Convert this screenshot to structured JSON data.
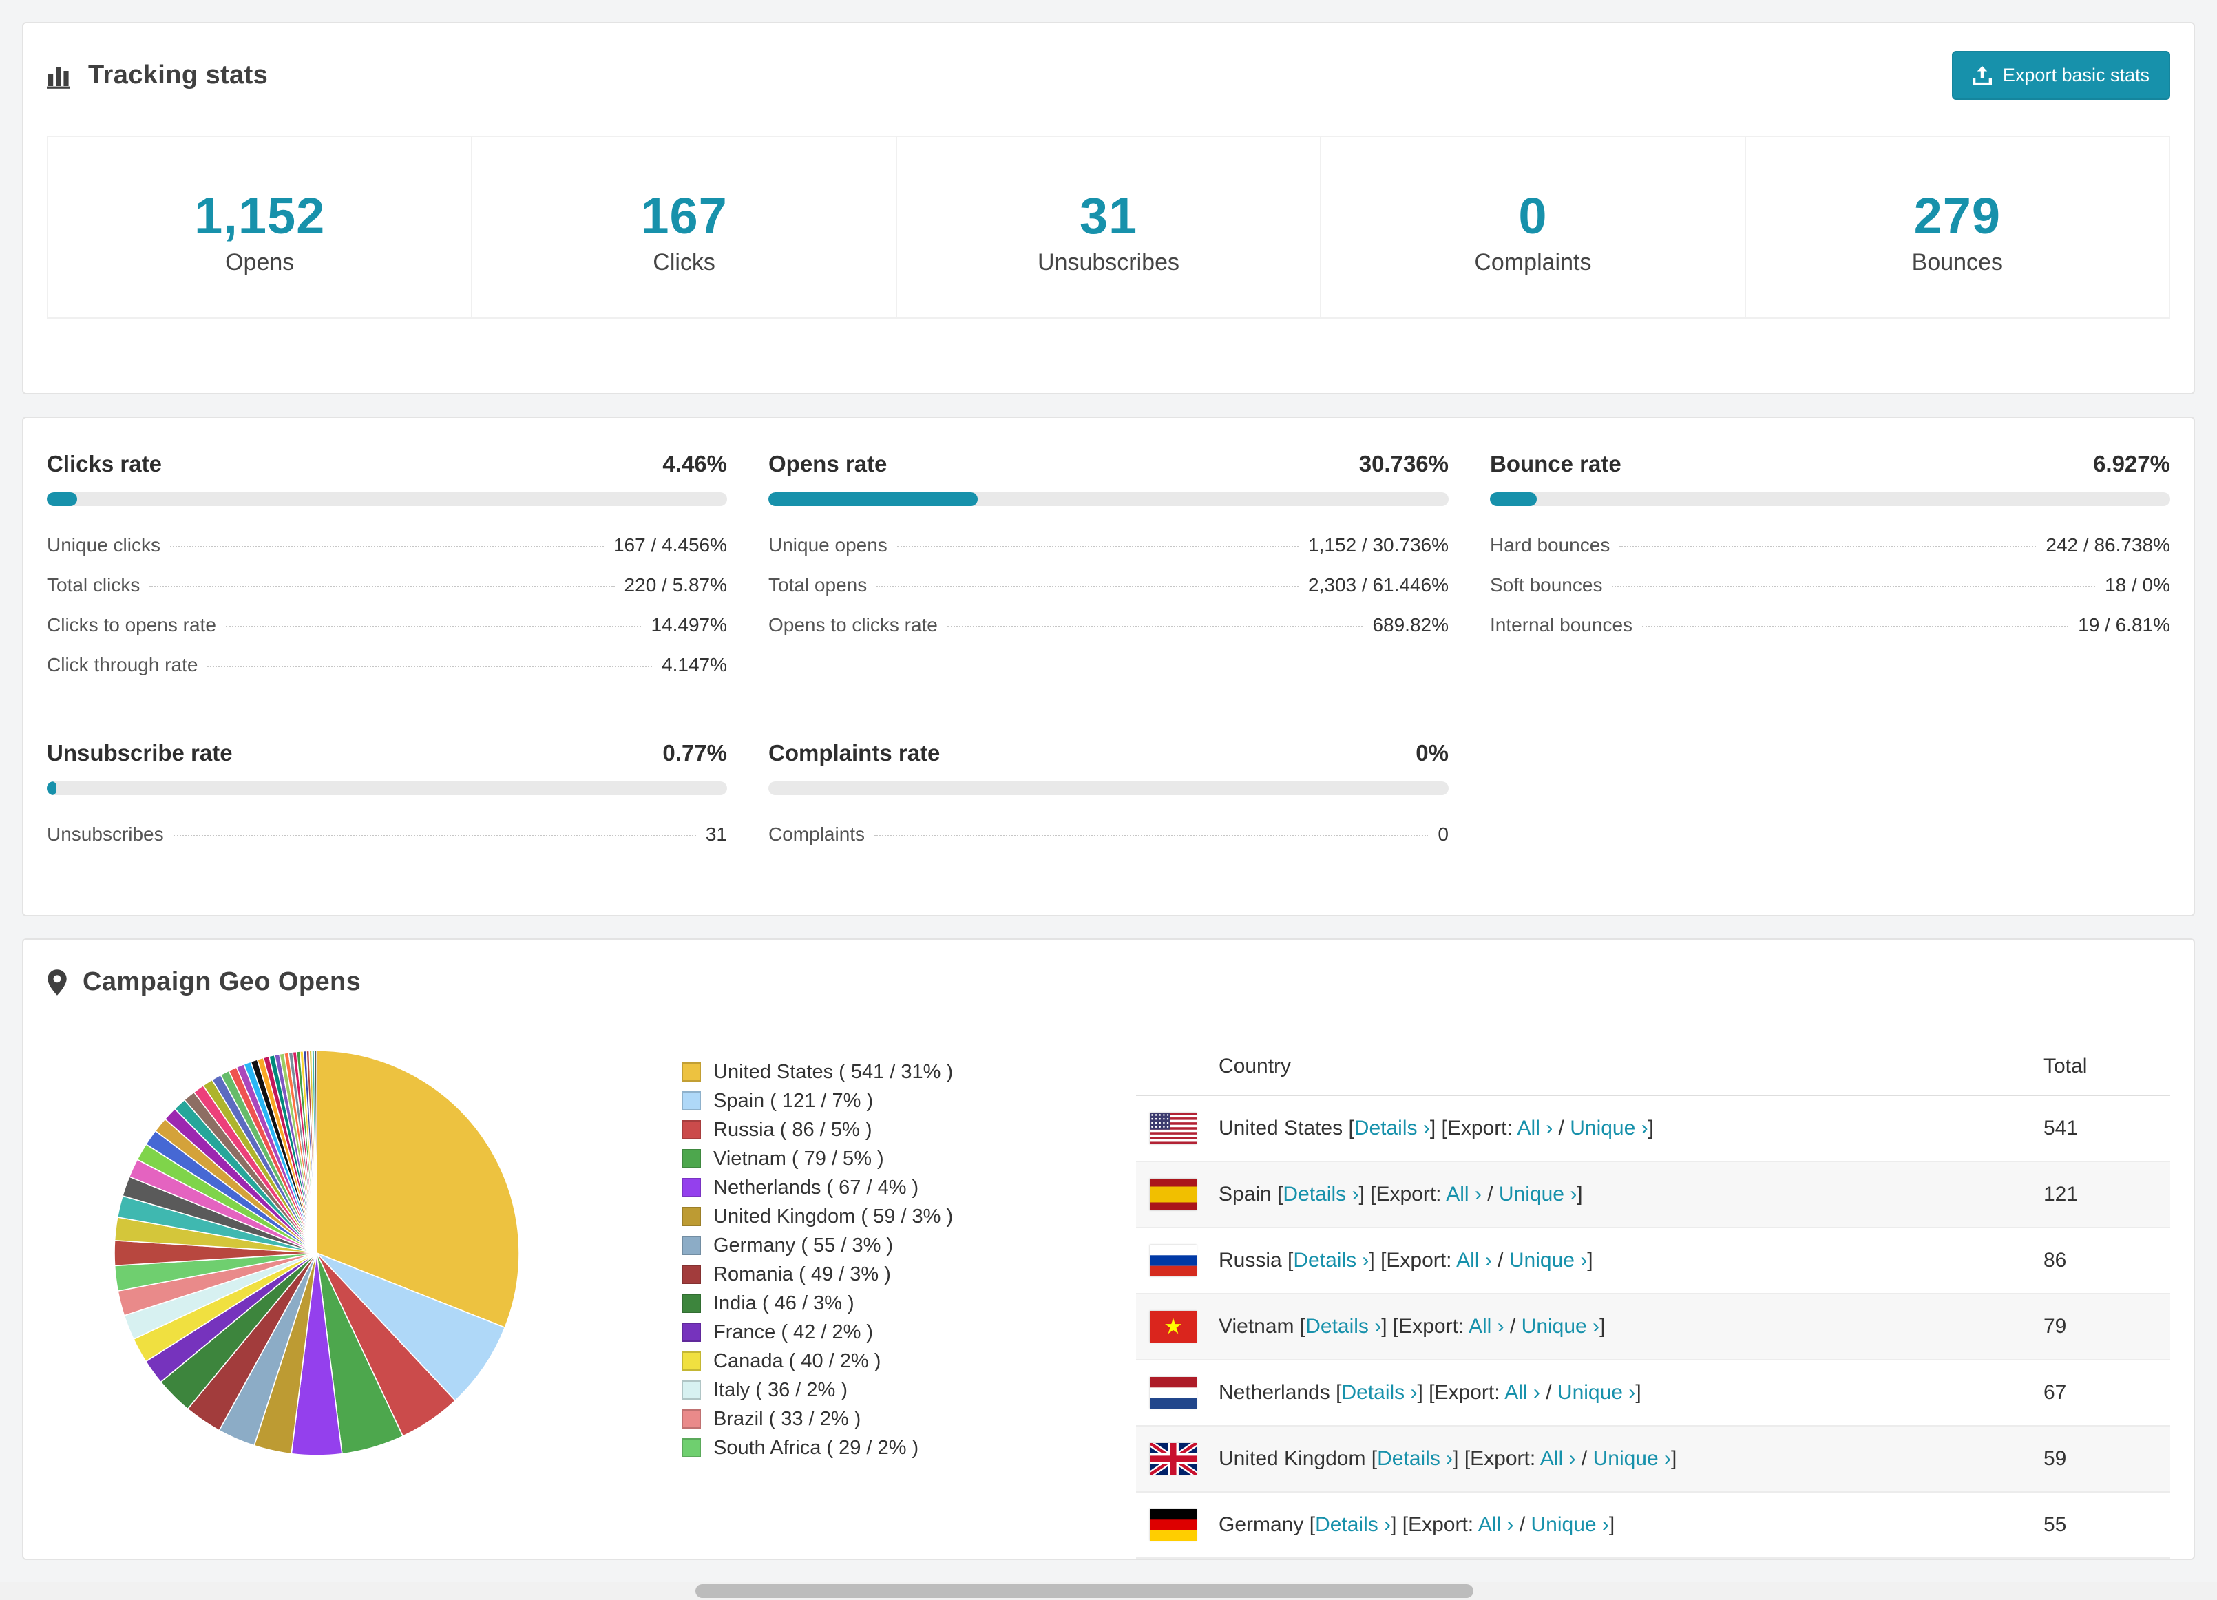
{
  "colors": {
    "accent": "#1791ab"
  },
  "header": {
    "title": "Tracking stats",
    "export_button": "Export basic stats"
  },
  "summary_stats": [
    {
      "value": "1,152",
      "label": "Opens"
    },
    {
      "value": "167",
      "label": "Clicks"
    },
    {
      "value": "31",
      "label": "Unsubscribes"
    },
    {
      "value": "0",
      "label": "Complaints"
    },
    {
      "value": "279",
      "label": "Bounces"
    }
  ],
  "rate_blocks": [
    {
      "title": "Clicks rate",
      "value": "4.46%",
      "percent": 4.46,
      "rows": [
        {
          "label": "Unique clicks",
          "value": "167 / 4.456%"
        },
        {
          "label": "Total clicks",
          "value": "220 / 5.87%"
        },
        {
          "label": "Clicks to opens rate",
          "value": "14.497%"
        },
        {
          "label": "Click through rate",
          "value": "4.147%"
        }
      ]
    },
    {
      "title": "Opens rate",
      "value": "30.736%",
      "percent": 30.736,
      "rows": [
        {
          "label": "Unique opens",
          "value": "1,152 / 30.736%"
        },
        {
          "label": "Total opens",
          "value": "2,303 / 61.446%"
        },
        {
          "label": "Opens to clicks rate",
          "value": "689.82%"
        }
      ]
    },
    {
      "title": "Bounce rate",
      "value": "6.927%",
      "percent": 6.927,
      "rows": [
        {
          "label": "Hard bounces",
          "value": "242 / 86.738%"
        },
        {
          "label": "Soft bounces",
          "value": "18 / 0%"
        },
        {
          "label": "Internal bounces",
          "value": "19 / 6.81%"
        }
      ]
    },
    {
      "title": "Unsubscribe rate",
      "value": "0.77%",
      "percent": 0.77,
      "rows": [
        {
          "label": "Unsubscribes",
          "value": "31"
        }
      ]
    },
    {
      "title": "Complaints rate",
      "value": "0%",
      "percent": 0,
      "rows": [
        {
          "label": "Complaints",
          "value": "0"
        }
      ]
    }
  ],
  "geo": {
    "title": "Campaign Geo Opens",
    "table_header": {
      "country": "Country",
      "total": "Total"
    },
    "link_labels": {
      "details": "Details ›",
      "export": "Export:",
      "all": "All ›",
      "unique": "Unique ›"
    },
    "rows": [
      {
        "country": "United States",
        "flag": "us",
        "total": "541"
      },
      {
        "country": "Spain",
        "flag": "es",
        "total": "121"
      },
      {
        "country": "Russia",
        "flag": "ru",
        "total": "86"
      },
      {
        "country": "Vietnam",
        "flag": "vn",
        "total": "79"
      },
      {
        "country": "Netherlands",
        "flag": "nl",
        "total": "67"
      },
      {
        "country": "United Kingdom",
        "flag": "gb",
        "total": "59"
      },
      {
        "country": "Germany",
        "flag": "de",
        "total": "55"
      }
    ]
  },
  "chart_data": {
    "type": "pie",
    "title": "Campaign Geo Opens",
    "legend_position": "right",
    "legend_format": "{label} ( {value} / {percent}% )",
    "slices": [
      {
        "label": "United States",
        "value": 541,
        "percent": 31,
        "color": "#EDC240"
      },
      {
        "label": "Spain",
        "value": 121,
        "percent": 7,
        "color": "#AFD8F8"
      },
      {
        "label": "Russia",
        "value": 86,
        "percent": 5,
        "color": "#CB4B4B"
      },
      {
        "label": "Vietnam",
        "value": 79,
        "percent": 5,
        "color": "#4DA74D"
      },
      {
        "label": "Netherlands",
        "value": 67,
        "percent": 4,
        "color": "#9440ED"
      },
      {
        "label": "United Kingdom",
        "value": 59,
        "percent": 3,
        "color": "#BD9B33"
      },
      {
        "label": "Germany",
        "value": 55,
        "percent": 3,
        "color": "#8CACC6"
      },
      {
        "label": "Romania",
        "value": 49,
        "percent": 3,
        "color": "#A23C3C"
      },
      {
        "label": "India",
        "value": 46,
        "percent": 3,
        "color": "#3D853D"
      },
      {
        "label": "France",
        "value": 42,
        "percent": 2,
        "color": "#7633BD"
      },
      {
        "label": "Canada",
        "value": 40,
        "percent": 2,
        "color": "#F0E040"
      },
      {
        "label": "Italy",
        "value": 36,
        "percent": 2,
        "color": "#D7F1F1"
      },
      {
        "label": "Brazil",
        "value": 33,
        "percent": 2,
        "color": "#E98A8A"
      },
      {
        "label": "South Africa",
        "value": 29,
        "percent": 2,
        "color": "#6FCF6F"
      }
    ],
    "others_percent": 26,
    "others_palette": [
      "#b8473f",
      "#d4c63a",
      "#3fb8b0",
      "#5a5a5a",
      "#e463c0",
      "#7fd44a",
      "#4668d4",
      "#d4a23a",
      "#9c27b0",
      "#26a69a",
      "#8d6e63",
      "#ec407a",
      "#aeb42c",
      "#5c6bc0",
      "#66bb6a",
      "#ef5350",
      "#ab47bc",
      "#29b6f6",
      "#111111",
      "#f9a825",
      "#c2185b",
      "#00897b",
      "#7e57c2",
      "#9ccc65",
      "#ff7043",
      "#78909c",
      "#d81b60",
      "#43a047",
      "#fdd835",
      "#3949ab"
    ]
  }
}
